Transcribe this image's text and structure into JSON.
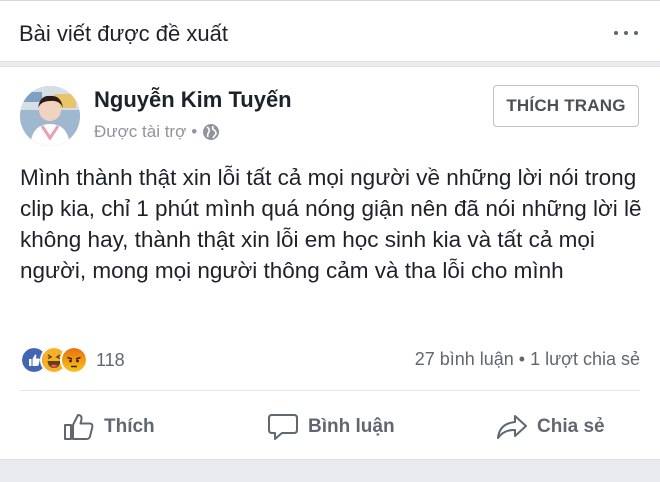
{
  "header": {
    "title": "Bài viết được đề xuất"
  },
  "post": {
    "author": "Nguyễn Kim Tuyến",
    "sponsored": "Được tài trợ",
    "meta_separator": "•",
    "like_page_label": "THÍCH TRANG",
    "text": "Mình thành thật xin lỗi tất cả mọi người về những lời nói trong clip kia, chỉ 1 phút mình quá nóng giận nên đã nói những lời lẽ không hay, thành thật xin lỗi em học sinh kia và tất cả mọi người, mong mọi người thông cảm và tha lỗi cho mình",
    "reaction_count": "118",
    "stats": "27 bình luận • 1 lượt chia sẻ"
  },
  "actions": {
    "like": "Thích",
    "comment": "Bình luận",
    "share": "Chia sẻ"
  },
  "colors": {
    "like_blue": "#4267b2",
    "haha_yellow": "#f7b125",
    "angry_red": "#e9710f",
    "text_gray": "#606770"
  },
  "icons": [
    "more-icon",
    "globe-icon",
    "like-reaction-icon",
    "haha-reaction-icon",
    "angry-reaction-icon",
    "thumbs-up-icon",
    "comment-icon",
    "share-icon"
  ]
}
